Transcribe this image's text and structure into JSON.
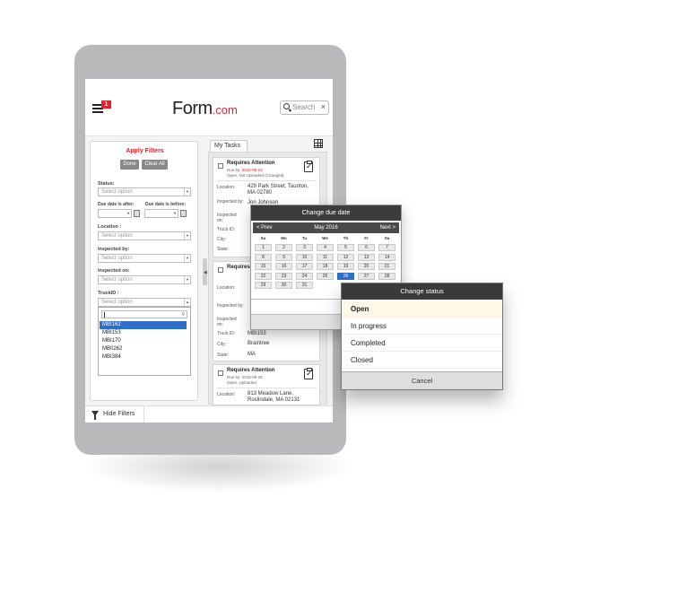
{
  "header": {
    "notification_count": "1",
    "logo_main": "Form",
    "logo_suffix": ".com",
    "search_placeholder": "Search",
    "search_clear": "×"
  },
  "filters": {
    "title": "Apply Filters",
    "done_label": "Done",
    "clear_all_label": "Clear All",
    "status_label": "Status:",
    "status_value": "Select option",
    "due_after_label": "Due date is after:",
    "due_before_label": "Due date is before:",
    "location_label": "Location :",
    "location_value": "Select option",
    "inspected_by_label": "Inspected by:",
    "inspected_by_value": "Select option",
    "inspected_on_label": "Inspected on:",
    "inspected_on_value": "Select option",
    "truck_id_label": "TruckID :",
    "truck_id_value": "Select option",
    "truck_options": [
      "MBI162",
      "MBI153",
      "MBI170",
      "MB0262",
      "MBI384"
    ],
    "truck_selected": "MBI162"
  },
  "footer": {
    "hide_filters_label": "Hide Filters"
  },
  "tasks": {
    "tab_label": "My Tasks",
    "cards": [
      {
        "title": "Requires Attention",
        "due_prefix": "Due by:",
        "due_date": "2016-05-24",
        "status": "Open, Not Uploaded (Changed)",
        "location_label": "Location:",
        "location": "429 Park Street, Taunton, MA 02780",
        "inspected_by_label": "Inspected by:",
        "inspected_by": "Jon Johnson",
        "inspected_on_label": "Inspected on:",
        "truck_label": "Truck ID:",
        "city_label": "City:",
        "state_label": "State:"
      },
      {
        "title": "Requires Attention",
        "location_label": "Location:",
        "inspected_by_label": "Inspected by:",
        "inspected_on_label": "Inspected on:",
        "truck_label": "Truck ID:",
        "truck_id": "MBI153",
        "city_label": "City:",
        "city": "Braintree",
        "state_label": "State:",
        "state": "MA"
      },
      {
        "title": "Requires Attention",
        "due_prefix": "Due by:",
        "due_date": "2016-05-26",
        "status": "Open, Uploaded",
        "location_label": "Location:",
        "location": "813 Meadow Lane, Roslindale, MA 02131"
      }
    ]
  },
  "date_popup": {
    "title": "Change due date",
    "prev_label": "< Prev",
    "month_label": "May 2016",
    "next_label": "Next >",
    "weekdays": [
      "Su",
      "Mo",
      "Tu",
      "We",
      "Th",
      "Fr",
      "Sa"
    ],
    "days": [
      "1",
      "2",
      "3",
      "4",
      "5",
      "6",
      "7",
      "8",
      "9",
      "10",
      "11",
      "12",
      "13",
      "14",
      "15",
      "16",
      "17",
      "18",
      "19",
      "20",
      "21",
      "22",
      "23",
      "24",
      "25",
      "26",
      "27",
      "28",
      "29",
      "30",
      "31"
    ],
    "selected_day": "26",
    "save_label": "Save",
    "cancel_label": "Cancel"
  },
  "status_popup": {
    "title": "Change status",
    "options": [
      "Open",
      "In progress",
      "Completed",
      "Closed"
    ],
    "selected": "Open",
    "cancel_label": "Cancel"
  },
  "colors": {
    "accent_red": "#e5222b",
    "selection_blue": "#2f6fc9",
    "dark_header": "#3c3c3c"
  }
}
